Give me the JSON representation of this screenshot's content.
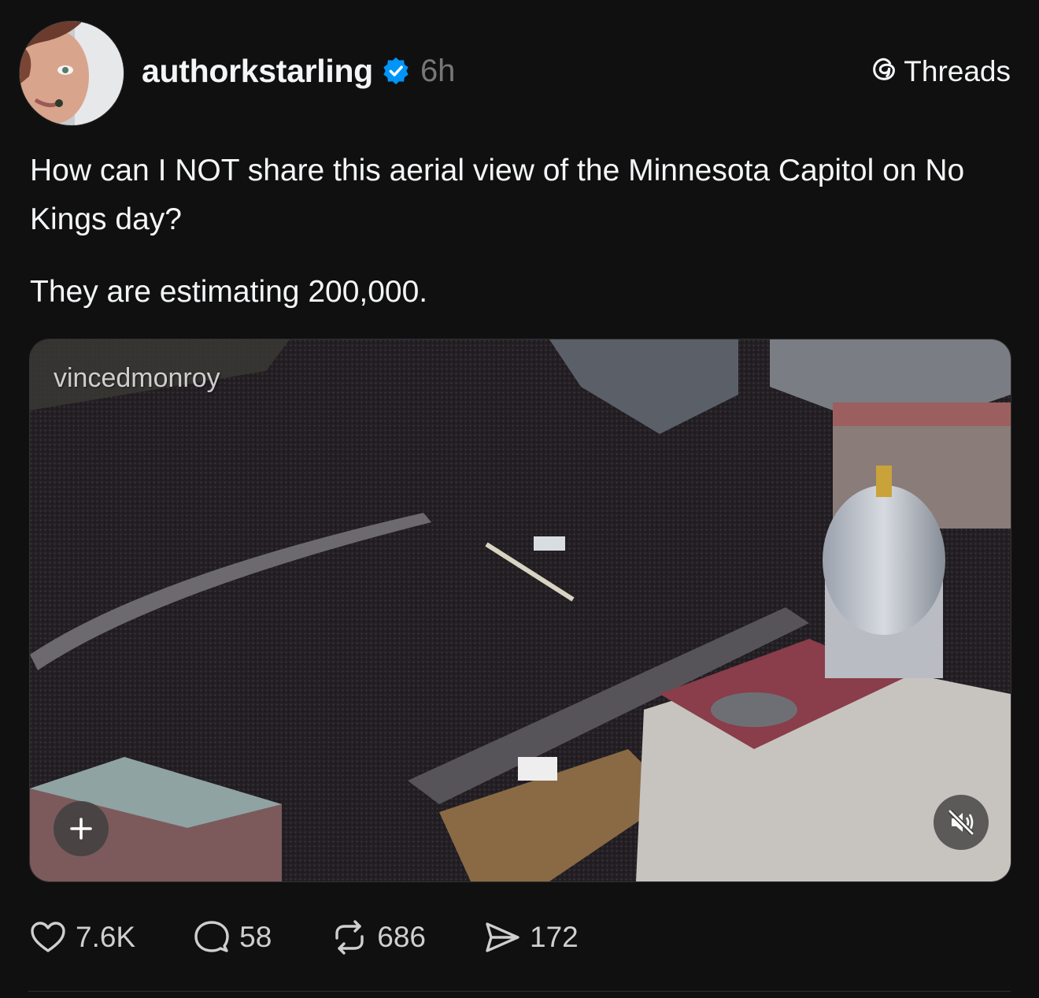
{
  "post": {
    "username": "authorkstarling",
    "verified": true,
    "timestamp": "6h",
    "platform_label": "Threads",
    "paragraphs": [
      "How can I NOT share this aerial view of the Minnesota Capitol on No Kings day?",
      "They are estimating 200,000."
    ]
  },
  "media": {
    "watermark": "vincedmonroy",
    "add_icon": "plus-icon",
    "mute_icon": "speaker-muted-icon"
  },
  "actions": {
    "likes": "7.6K",
    "replies": "58",
    "reposts": "686",
    "shares": "172"
  },
  "colors": {
    "background": "#101010",
    "text": "#f3f5f7",
    "muted": "#777777",
    "verified": "#0095f6"
  }
}
